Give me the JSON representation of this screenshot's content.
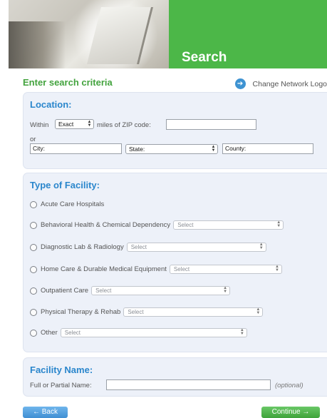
{
  "header": {
    "title": "Search"
  },
  "subheader": {
    "criteria": "Enter search criteria",
    "network_link": "Change Network Logo"
  },
  "location": {
    "title": "Location:",
    "within": "Within",
    "distance_selected": "Exact",
    "miles_text": "miles of ZIP code:",
    "zip_value": "",
    "or_text": "or",
    "city_placeholder": "City:",
    "state_selected": "State:",
    "county_placeholder": "County:"
  },
  "facility_type": {
    "title": "Type of Facility:",
    "options": [
      {
        "label": "Acute Care Hospitals",
        "select": ""
      },
      {
        "label": "Behavioral Health & Chemical Dependency",
        "select": "Select"
      },
      {
        "label": "Diagnostic Lab & Radiology",
        "select": "Select"
      },
      {
        "label": "Home Care & Durable Medical Equipment",
        "select": "Select"
      },
      {
        "label": "Outpatient Care",
        "select": "Select"
      },
      {
        "label": "Physical Therapy & Rehab",
        "select": "Select"
      },
      {
        "label": "Other",
        "select": "Select"
      }
    ]
  },
  "facility_name": {
    "title": "Facility Name:",
    "label": "Full or Partial Name:",
    "value": "",
    "optional": "(optional)"
  },
  "buttons": {
    "back": "← Back",
    "continue": "Continue →"
  }
}
